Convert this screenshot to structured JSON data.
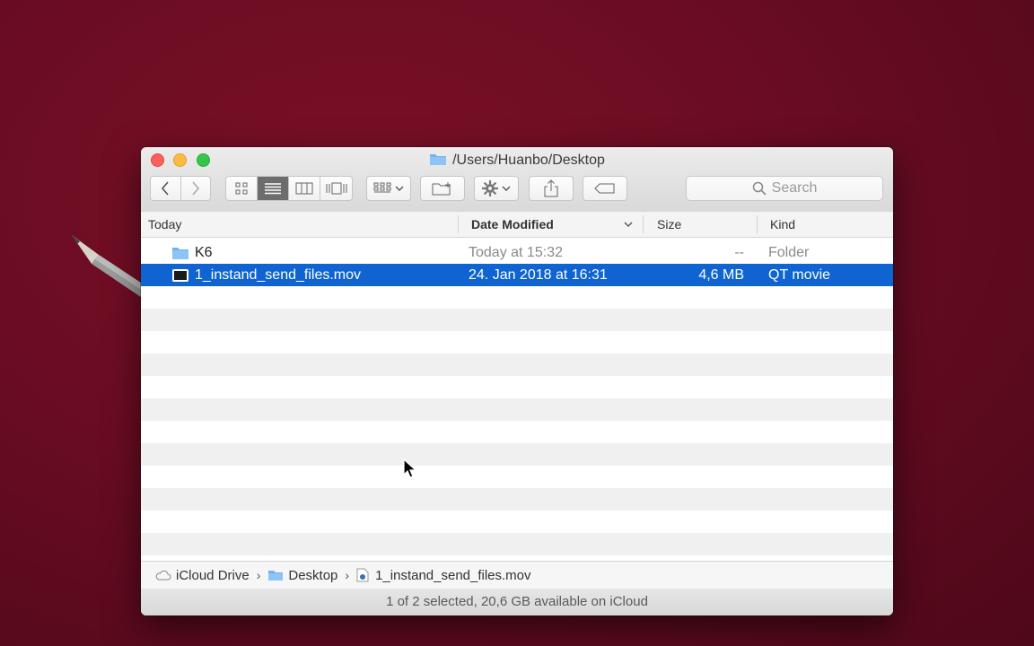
{
  "window": {
    "title": "/Users/Huanbo/Desktop"
  },
  "toolbar": {
    "back_icon": "chevron-left-icon",
    "forward_icon": "chevron-right-icon",
    "view_modes": [
      "icon-view",
      "list-view",
      "column-view",
      "cover-flow-view"
    ],
    "active_view": "list-view",
    "search_placeholder": "Search"
  },
  "columns": {
    "name": "Today",
    "date": "Date Modified",
    "size": "Size",
    "kind": "Kind"
  },
  "files": [
    {
      "name": "K6",
      "date": "Today at 15:32",
      "size": "--",
      "kind": "Folder",
      "icon": "folder-icon",
      "selected": false
    },
    {
      "name": "1_instand_send_files.mov",
      "date": "24. Jan 2018 at 16:31",
      "size": "4,6 MB",
      "kind": "QT movie",
      "icon": "movie-file-icon",
      "selected": true
    }
  ],
  "pathbar": {
    "items": [
      "iCloud Drive",
      "Desktop",
      "1_instand_send_files.mov"
    ]
  },
  "status": "1 of 2 selected, 20,6 GB available on iCloud",
  "colors": {
    "selection": "#0f64d2",
    "background": "#6a0c22"
  }
}
